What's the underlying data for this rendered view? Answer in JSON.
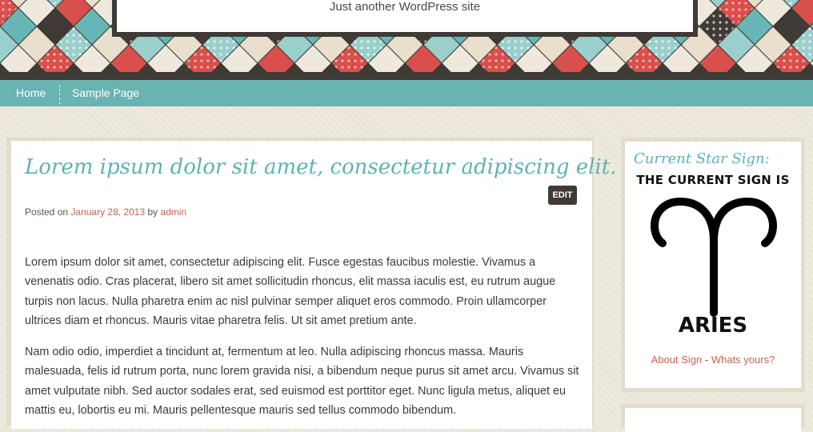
{
  "header": {
    "tagline": "Just another WordPress site",
    "pattern_colors": [
      "#67b5b4",
      "#d94f4c",
      "#e9dfcc",
      "#3f3a35",
      "#efe9dd",
      "#9bcfcb"
    ]
  },
  "nav": {
    "items": [
      {
        "label": "Home"
      },
      {
        "label": "Sample Page"
      }
    ],
    "background": "#69b3b1"
  },
  "post": {
    "title": "Lorem ipsum dolor sit amet, consectetur adipiscing elit.",
    "edit_label": "EDIT",
    "meta": {
      "posted_on": "Posted on",
      "date": "January 28, 2013",
      "by": "by",
      "author": "admin"
    },
    "paragraphs": [
      "Lorem ipsum dolor sit amet, consectetur adipiscing elit. Fusce egestas faucibus molestie. Vivamus a venenatis odio. Cras placerat, libero sit amet sollicitudin rhoncus, elit massa iaculis est, eu rutrum augue turpis non lacus. Nulla pharetra enim ac nisl pulvinar semper aliquet eros commodo. Proin ullamcorper ultrices diam et rhoncus. Mauris vitae pharetra felis. Ut sit amet pretium ante.",
      "Nam odio odio, imperdiet a tincidunt at, fermentum at leo. Nulla adipiscing rhoncus massa. Mauris malesuada, felis id rutrum porta, nunc lorem gravida nisi, a bibendum neque purus sit amet arcu. Vivamus sit amet vulputate nibh. Sed auctor sodales erat, sed euismod est porttitor eget. Nunc ligula metus, aliquet eu mattis eu, lobortis eu mi. Mauris pellentesque mauris sed tellus commodo bibendum."
    ]
  },
  "sidebar": {
    "widget_title": "Current Star Sign:",
    "sign_heading": "THE CURRENT SIGN IS",
    "sign_icon": "aries-symbol-icon",
    "sign_name": "ARIES",
    "links": {
      "about": "About Sign",
      "separator": " - ",
      "whats_yours": "Whats yours?"
    }
  },
  "colors": {
    "accent_teal": "#5fb2b3",
    "link_red": "#d16050",
    "dark": "#3f3a35"
  }
}
